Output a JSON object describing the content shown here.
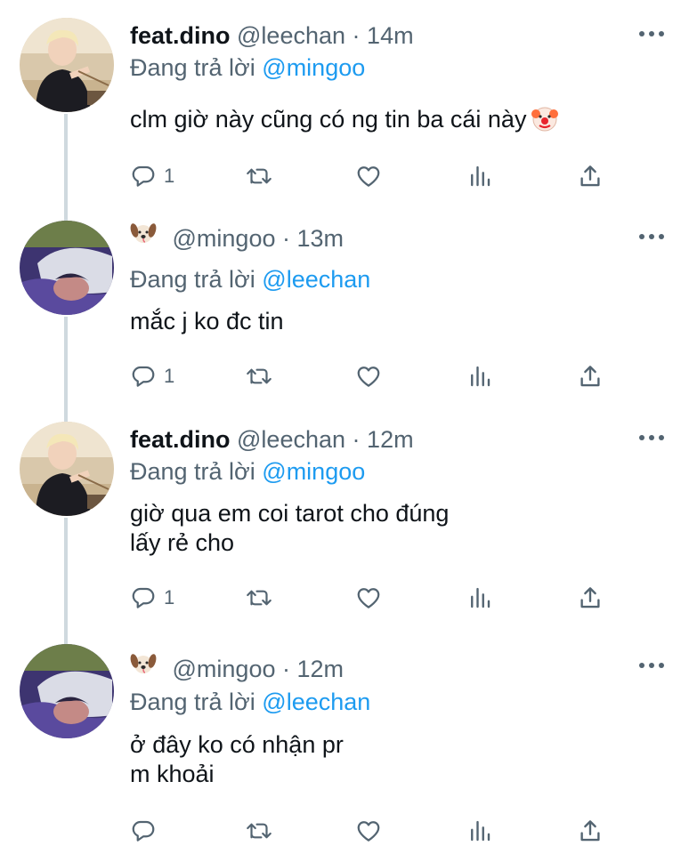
{
  "tweets": [
    {
      "display_name": "feat.dino",
      "handle": "@leechan",
      "separator": "·",
      "time": "14m",
      "reply_prefix": "Đang trả lời",
      "reply_to": "@mingoo",
      "lines": [
        "clm giờ này cũng có ng tin ba cái này"
      ],
      "reply_count": "1",
      "avatar": "man-photo-avatar",
      "trailing_emoji": "clown-face"
    },
    {
      "display_name": "",
      "name_emoji": "dog-face",
      "handle": "@mingoo",
      "separator": "·",
      "time": "13m",
      "reply_prefix": "Đang trả lời",
      "reply_to": "@leechan",
      "lines": [
        "mắc j ko đc tin"
      ],
      "reply_count": "1",
      "avatar": "sleeping-person-avatar"
    },
    {
      "display_name": "feat.dino",
      "handle": "@leechan",
      "separator": "·",
      "time": "12m",
      "reply_prefix": "Đang trả lời",
      "reply_to": "@mingoo",
      "lines": [
        "giờ qua em coi tarot cho đúng",
        "lấy rẻ cho"
      ],
      "reply_count": "1",
      "avatar": "man-photo-avatar"
    },
    {
      "display_name": "",
      "name_emoji": "dog-face",
      "handle": "@mingoo",
      "separator": "·",
      "time": "12m",
      "reply_prefix": "Đang trả lời",
      "reply_to": "@leechan",
      "lines": [
        "ở đây ko có nhận pr",
        "m khoải"
      ],
      "reply_count": "",
      "avatar": "sleeping-person-avatar"
    }
  ],
  "colors": {
    "text": "#0f1419",
    "secondary": "#536471",
    "mention": "#1d9bf0",
    "thread_line": "#cfd9de"
  },
  "icons": {
    "reply": "reply-icon",
    "retweet": "retweet-icon",
    "like": "heart-icon",
    "views": "views-icon",
    "share": "share-icon",
    "more": "more-icon"
  }
}
